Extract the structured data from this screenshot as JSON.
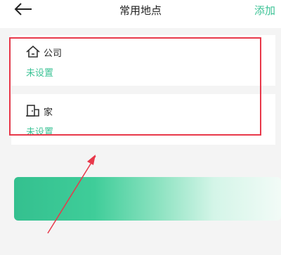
{
  "header": {
    "title": "常用地点",
    "add_label": "添加"
  },
  "places": [
    {
      "name": "公司",
      "status": "未设置",
      "icon": "house-icon"
    },
    {
      "name": "家",
      "status": "未设置",
      "icon": "door-icon"
    }
  ],
  "colors": {
    "accent": "#3cc396",
    "annotation": "#e8384a"
  }
}
